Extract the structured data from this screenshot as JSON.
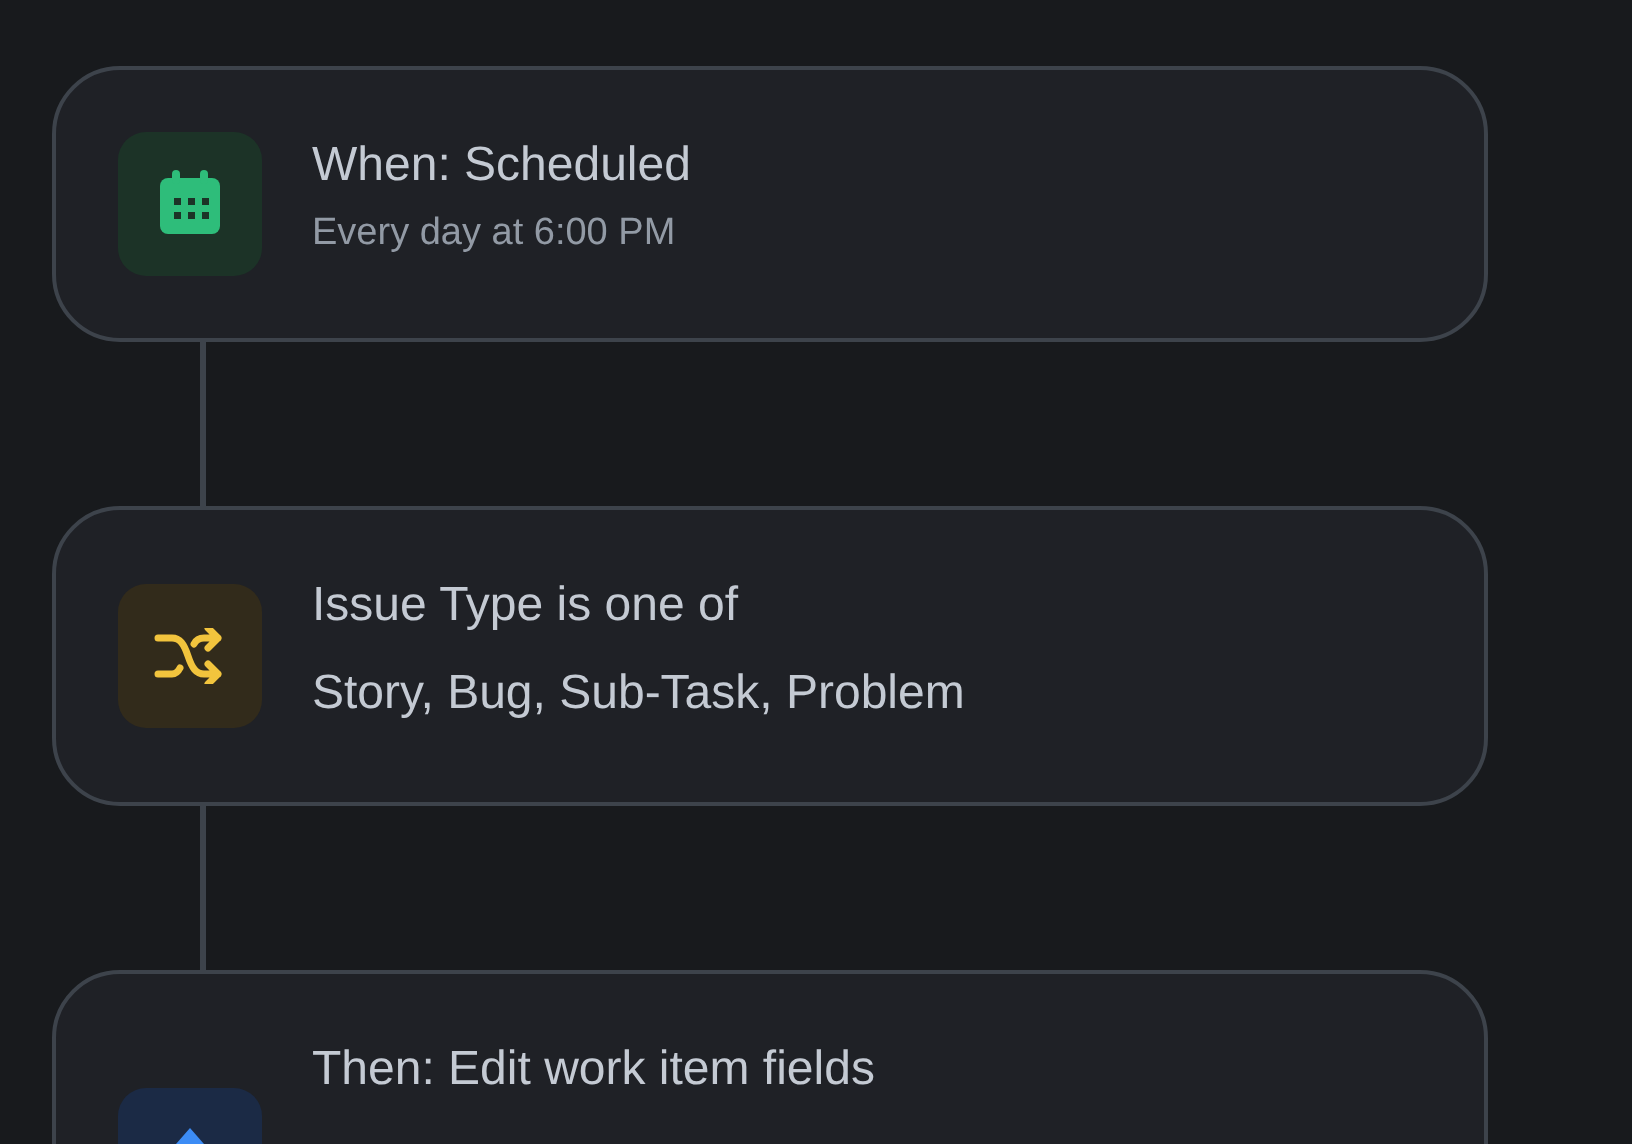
{
  "steps": [
    {
      "kind": "trigger",
      "title": "When: Scheduled",
      "details": [
        "Every day at 6:00 PM"
      ]
    },
    {
      "kind": "condition",
      "title": "Issue Type is one of",
      "details": [
        "Story, Bug, Sub-Task, Problem"
      ]
    },
    {
      "kind": "action",
      "title": "Then: Edit work item fields"
    }
  ]
}
